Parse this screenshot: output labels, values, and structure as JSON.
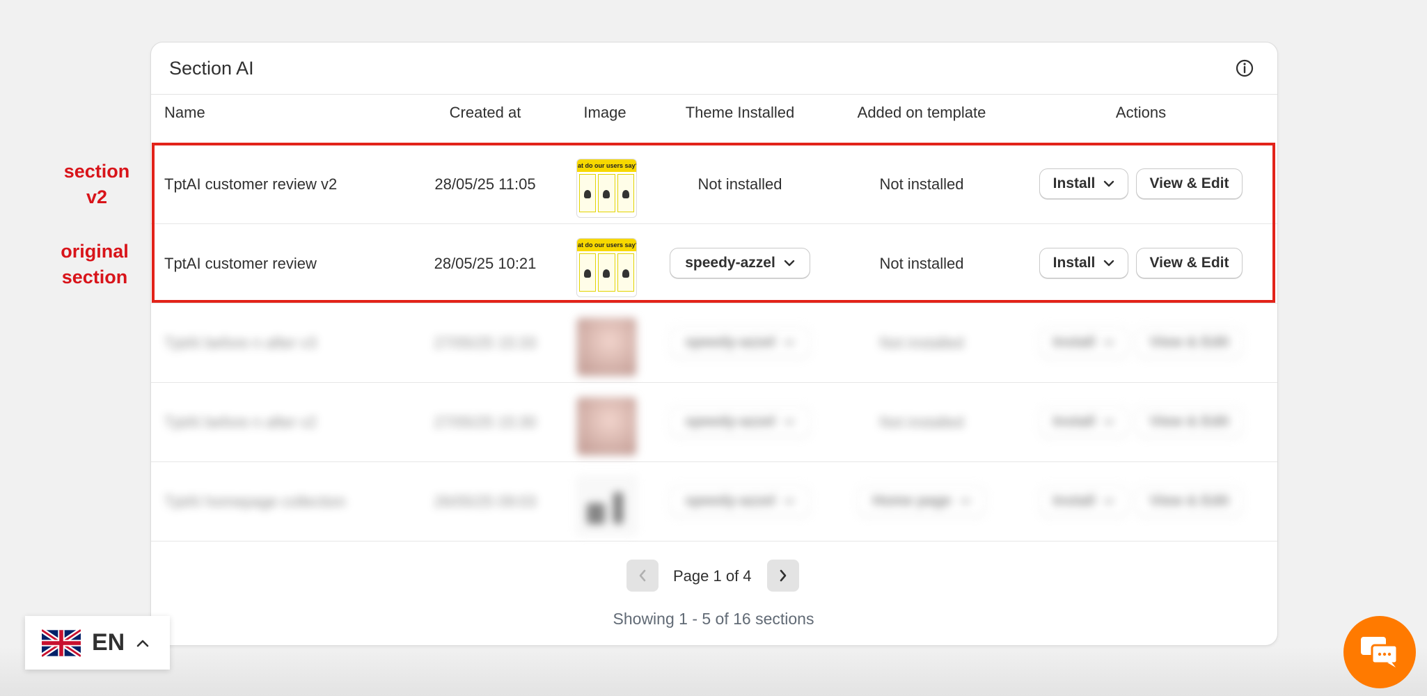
{
  "card": {
    "title": "Section AI"
  },
  "table": {
    "headers": [
      "Name",
      "Created at",
      "Image",
      "Theme Installed",
      "Added on template",
      "Actions"
    ],
    "rows": [
      {
        "name": "TptAI customer review v2",
        "created": "28/05/25 11:05",
        "image": "customer-review-thumbnail",
        "image_text": "at do our users say?",
        "theme": "Not installed",
        "template": "Not installed",
        "install": "Install",
        "view": "View & Edit"
      },
      {
        "name": "TptAI customer review",
        "created": "28/05/25 10:21",
        "image": "customer-review-thumbnail",
        "image_text": "at do our users say?",
        "theme": "speedy-azzel",
        "template": "Not installed",
        "install": "Install",
        "view": "View & Edit"
      },
      {
        "name": "TptAI before n after v3",
        "created": "27/05/25 15:33",
        "image": "before-after-thumbnail",
        "theme": "speedy-azzel",
        "template": "Not installed",
        "install": "Install",
        "view": "View & Edit"
      },
      {
        "name": "TptAI before n after v2",
        "created": "27/05/25 15:30",
        "image": "before-after-thumbnail",
        "theme": "speedy-azzel",
        "template": "Not installed",
        "install": "Install",
        "view": "View & Edit"
      },
      {
        "name": "TptAI homepage collection",
        "created": "26/05/25 09:03",
        "image": "collection-thumbnail",
        "theme": "speedy-azzel",
        "template": "Home page",
        "install": "Install",
        "view": "View & Edit"
      }
    ]
  },
  "annotations": {
    "first": "section\nv2",
    "second": "original\nsection",
    "color": "#d8141a"
  },
  "pagination": {
    "page_label": "Page 1 of 4",
    "showing": "Showing 1 - 5 of 16 sections"
  },
  "language": {
    "code": "EN"
  },
  "colors": {
    "chat": "#ff7a00",
    "highlight": "#e2231a"
  }
}
